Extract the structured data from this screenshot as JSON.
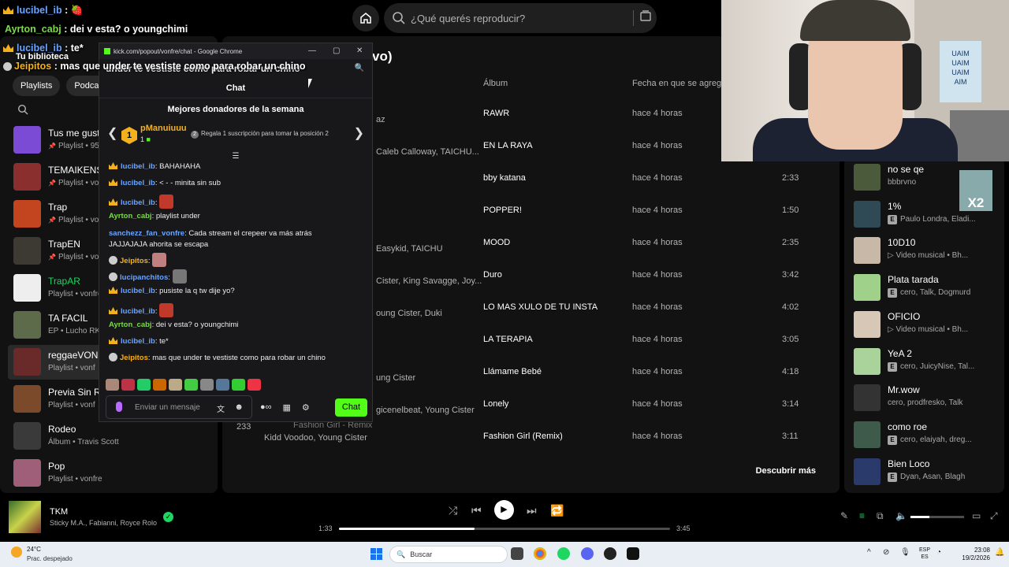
{
  "spotify": {
    "search_placeholder": "¿Qué querés reproducir?",
    "library": {
      "title": "Tu biblioteca",
      "chips": [
        "Playlists",
        "Podcasts"
      ],
      "items": [
        {
          "name": "Tus me gusta",
          "sub": "Playlist • 95",
          "pinned": true,
          "color": "#7b4bd6"
        },
        {
          "name": "TEMAIKENS",
          "sub": "Playlist • vonf",
          "pinned": true,
          "color": "#8a2e2e"
        },
        {
          "name": "Trap",
          "sub": "Playlist • vonf",
          "pinned": true,
          "color": "#c2451f"
        },
        {
          "name": "TrapEN",
          "sub": "Playlist • vonf",
          "pinned": true,
          "color": "#3d3a33"
        },
        {
          "name": "TrapAR",
          "sub": "Playlist • vonfre",
          "pinned": false,
          "color": "#eeeeee",
          "green": true
        },
        {
          "name": "TA FACIL",
          "sub": "EP • Lucho RK",
          "pinned": false,
          "color": "#5d6b4b"
        },
        {
          "name": "reggaeVON",
          "sub": "Playlist • vonf",
          "pinned": false,
          "color": "#6b2a2a",
          "selected": true
        },
        {
          "name": "Previa Sin Re",
          "sub": "Playlist • vonf",
          "pinned": false,
          "color": "#7a4a2a"
        },
        {
          "name": "Rodeo",
          "sub": "Álbum • Travis Scott",
          "pinned": false,
          "color": "#3a3a3a"
        },
        {
          "name": "Pop",
          "sub": "Playlist • vonfre",
          "pinned": false,
          "color": "#a05f78"
        }
      ]
    },
    "main": {
      "title_fragment": "vo)",
      "headers": {
        "album": "Álbum",
        "added": "Fecha en que se agregó"
      },
      "rows": [
        {
          "artist": "az",
          "album": "RAWR",
          "added": "hace 4 horas",
          "duration": ""
        },
        {
          "artist": "Caleb Calloway, TAICHU...",
          "album": "EN LA RAYA",
          "added": "hace 4 horas",
          "duration": ""
        },
        {
          "artist": "",
          "album": "bby katana",
          "added": "hace 4 horas",
          "duration": "2:33"
        },
        {
          "artist": "",
          "album": "POPPER!",
          "added": "hace 4 horas",
          "duration": "1:50"
        },
        {
          "artist": "Easykid, TAICHU",
          "album": "MOOD",
          "added": "hace 4 horas",
          "duration": "2:35"
        },
        {
          "artist": "Cister, King Savagge, Joy...",
          "album": "Duro",
          "added": "hace 4 horas",
          "duration": "3:42"
        },
        {
          "artist": "oung Cister, Duki",
          "album": "LO MAS XULO DE TU INSTA",
          "added": "hace 4 horas",
          "duration": "4:02"
        },
        {
          "artist": "",
          "album": "LA TERAPIA",
          "added": "hace 4 horas",
          "duration": "3:05"
        },
        {
          "artist": "ung Cister",
          "album": "Llámame Bebé",
          "added": "hace 4 horas",
          "duration": "4:18"
        },
        {
          "artist": "gicenelbeat, Young Cister",
          "album": "Lonely",
          "added": "hace 4 horas",
          "duration": "3:14"
        },
        {
          "artist": "Kidd Voodoo, Young Cister",
          "album": "Fashion Girl (Remix)",
          "added": "hace 4 horas",
          "duration": "3:11",
          "num": "233",
          "title": "Fashion Girl - Remix"
        }
      ],
      "discover": "Descubrir más"
    },
    "queue": {
      "badge": "X2",
      "items": [
        {
          "name": "no se qe",
          "sub": "bbbrvno",
          "explicit": false,
          "video": false,
          "color": "#4a5a3a"
        },
        {
          "name": "1%",
          "sub": "Paulo Londra, Eladi...",
          "explicit": true,
          "video": false,
          "color": "#2f4a55"
        },
        {
          "name": "10D10",
          "sub": "Video musical • Bh...",
          "explicit": false,
          "video": true,
          "color": "#c8b8a8"
        },
        {
          "name": "Plata tarada",
          "sub": "cero, Talk, Dogmurd",
          "explicit": true,
          "video": false,
          "color": "#9fd18a"
        },
        {
          "name": "OFICIO",
          "sub": "Video musical • Bh...",
          "explicit": false,
          "video": true,
          "color": "#d7c7b7"
        },
        {
          "name": "YeA 2",
          "sub": "cero, JuicyNise, Tal...",
          "explicit": true,
          "video": false,
          "color": "#a9d39a"
        },
        {
          "name": "Mr.wow",
          "sub": "cero, prodfresko, Talk",
          "explicit": false,
          "video": false,
          "color": "#333333"
        },
        {
          "name": "como roe",
          "sub": "cero, elaiyah, dreg...",
          "explicit": true,
          "video": false,
          "color": "#3d5a4a"
        },
        {
          "name": "Bien Loco",
          "sub": "Dyan, Asan, Blagh",
          "explicit": true,
          "video": false,
          "color": "#2a3a6a"
        }
      ]
    },
    "player": {
      "title": "TKM",
      "artist": "Sticky M.A., Fabianni, Royce Rolo",
      "elapsed": "1:33",
      "total": "3:45",
      "progress": 0.41,
      "volume": 0.35
    }
  },
  "chat_window": {
    "window_title": "kick.com/popout/vonfre/chat - Google Chrome",
    "url_overlay": "under te vestiste como para robar un chino",
    "header": "Chat",
    "donors_title": "Mejores donadores de la semana",
    "donor": {
      "rank": "1",
      "name": "pManuiuuu",
      "count": "1",
      "gift_text": "Regala 1 suscripción para tomar la posición 2"
    },
    "messages": [
      {
        "user": "lucibel_ib",
        "color": "#6aa5ff",
        "text": "BAHAHAHA",
        "crown": true
      },
      {
        "user": "lucibel_ib",
        "color": "#6aa5ff",
        "text": "< - - minita sin sub",
        "crown": true
      },
      {
        "user": "lucibel_ib",
        "color": "#6aa5ff",
        "text": "",
        "crown": true,
        "emote": "#c0392b"
      },
      {
        "user": "Ayrton_cabj",
        "color": "#7bd94a",
        "text": "playlist under",
        "crown": false
      },
      {
        "user": "sanchezz_fan_vonfre",
        "color": "#6aa5ff",
        "text": "Cada stream el crepeer va más atrás",
        "text2": "JAJJAJAJA ahorita se escapa",
        "crown": false
      },
      {
        "user": "Jeipitos",
        "color": "#f3b11d",
        "text": "",
        "crown": false,
        "badge": true,
        "emote": "#c08080"
      },
      {
        "user": "lucipanchitos",
        "color": "#6aa5ff",
        "text": "",
        "crown": false,
        "badge": true,
        "emote": "#777"
      },
      {
        "user": "lucibel_ib",
        "color": "#6aa5ff",
        "text": "pusiste la q tw dije yo?",
        "crown": true
      },
      {
        "user": "lucibel_ib",
        "color": "#6aa5ff",
        "text": "",
        "crown": true,
        "emote": "#c0392b"
      },
      {
        "user": "Ayrton_cabj",
        "color": "#7bd94a",
        "text": "dei v esta? o youngchimi",
        "crown": false
      },
      {
        "user": "lucibel_ib",
        "color": "#6aa5ff",
        "text": "te*",
        "crown": true
      },
      {
        "user": "Jeipitos",
        "color": "#f3b11d",
        "text": "mas que under te vestiste como para robar un chino",
        "crown": false,
        "badge": true
      }
    ],
    "input_placeholder": "Enviar un mensaje",
    "chat_button": "Chat"
  },
  "overlay": [
    {
      "user": "lucibel_ib",
      "text": " : 🍓",
      "color": "#6aa5ff",
      "crown": true
    },
    {
      "user": "Ayrton_cabj",
      "text": " : dei v esta? o youngchimi",
      "color": "#7bd94a",
      "crown": false
    },
    {
      "user": "lucibel_ib",
      "text": " : te*",
      "color": "#6aa5ff",
      "crown": true
    },
    {
      "user": "Jeipitos",
      "text": " : mas que under te vestiste como para robar un chino",
      "color": "#f3b11d",
      "crown": false
    }
  ],
  "webcam": {
    "poster_text": "UAIM\nUAIM\nUAIM\nAIM"
  },
  "taskbar": {
    "temp": "24°C",
    "weather": "Prac. despejado",
    "search": "Buscar",
    "lang1": "ESP",
    "lang2": "ES",
    "time": "23:08",
    "date": "19/2/2026"
  }
}
